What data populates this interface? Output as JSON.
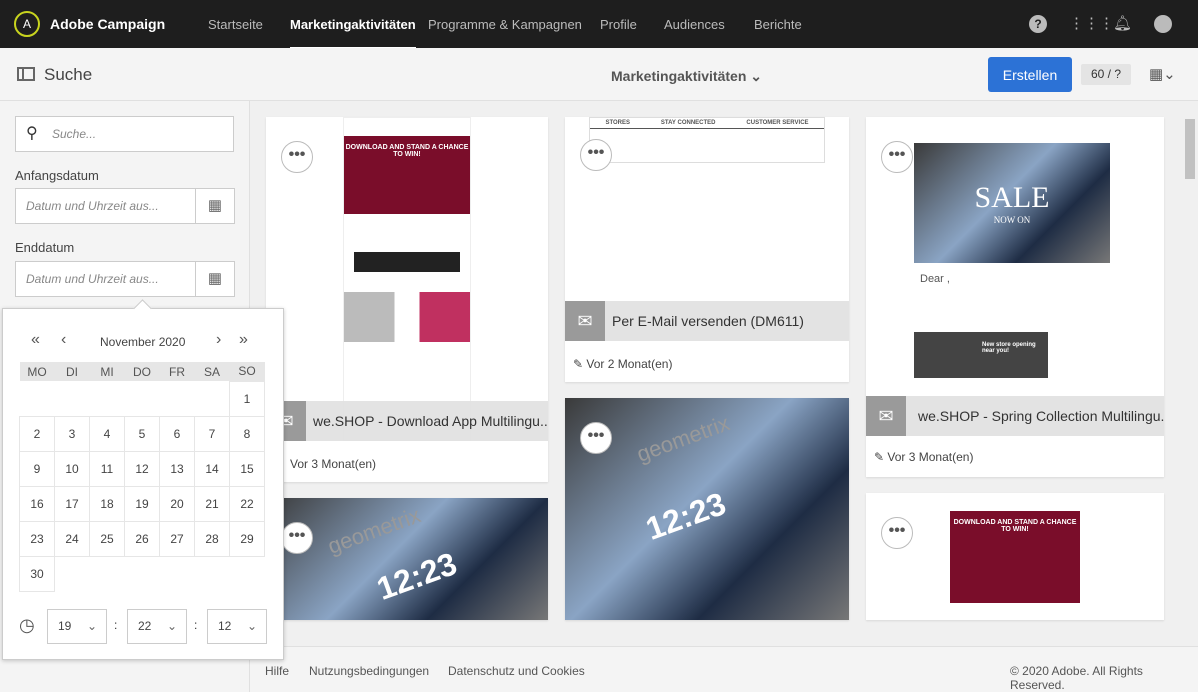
{
  "topbar": {
    "brand": "Adobe Campaign",
    "nav": [
      "Startseite",
      "Marketingaktivitäten",
      "Programme & Kampagnen",
      "Profile",
      "Audiences",
      "Berichte"
    ],
    "active": "Marketingaktivitäten",
    "icons": [
      "help-icon",
      "apps-icon",
      "bell-icon",
      "user-icon"
    ]
  },
  "subheader": {
    "title": "Suche",
    "breadcrumb": "Marketingaktivitäten",
    "create": "Erstellen",
    "count": "60 / ?"
  },
  "search": {
    "placeholder": "Suche...",
    "start_label": "Anfangsdatum",
    "start_placeholder": "Datum und Uhrzeit aus...",
    "end_label": "Enddatum",
    "end_placeholder": "Datum und Uhrzeit aus..."
  },
  "calendar": {
    "month": "November 2020",
    "weekdays": [
      "MO",
      "DI",
      "MI",
      "DO",
      "FR",
      "SA",
      "SO"
    ],
    "weeks": [
      [
        "",
        "",
        "",
        "",
        "",
        "",
        "1"
      ],
      [
        "2",
        "3",
        "4",
        "5",
        "6",
        "7",
        "8"
      ],
      [
        "9",
        "10",
        "11",
        "12",
        "13",
        "14",
        "15"
      ],
      [
        "16",
        "17",
        "18",
        "19",
        "20",
        "21",
        "22"
      ],
      [
        "23",
        "24",
        "25",
        "26",
        "27",
        "28",
        "29"
      ],
      [
        "30",
        "",
        "",
        "",
        "",
        "",
        ""
      ]
    ],
    "hour": "19",
    "minute": "22",
    "second": "12"
  },
  "cards": [
    {
      "title": "we.SHOP - Download App Multilingu...",
      "meta": "Vor 3 Monat(en)",
      "thumb_text": "DOWNLOAD AND STAND A CHANCE TO WIN!"
    },
    {
      "title": "Per E-Mail versenden  (DM611)",
      "meta": "Vor 2 Monat(en)",
      "thumb_cols": [
        "STORES",
        "STAY CONNECTED",
        "CUSTOMER SERVICE"
      ]
    },
    {
      "title": "we.SHOP - Spring Collection Multilingu...",
      "meta": "Vor 3 Monat(en)",
      "thumb_text": "SALE",
      "thumb_sub": "NOW ON",
      "greeting": "Dear ,",
      "store": "New store opening near you!"
    },
    {
      "thumb_text": "geometrix",
      "clock": "12:23"
    },
    {
      "thumb_text": "geometrix",
      "clock": "12:23"
    },
    {
      "thumb_text": "DOWNLOAD AND STAND A CHANCE TO WIN!"
    }
  ],
  "footer": {
    "links": [
      "Hilfe",
      "Nutzungsbedingungen",
      "Datenschutz und Cookies"
    ],
    "copyright": "© 2020 Adobe. All Rights Reserved."
  }
}
